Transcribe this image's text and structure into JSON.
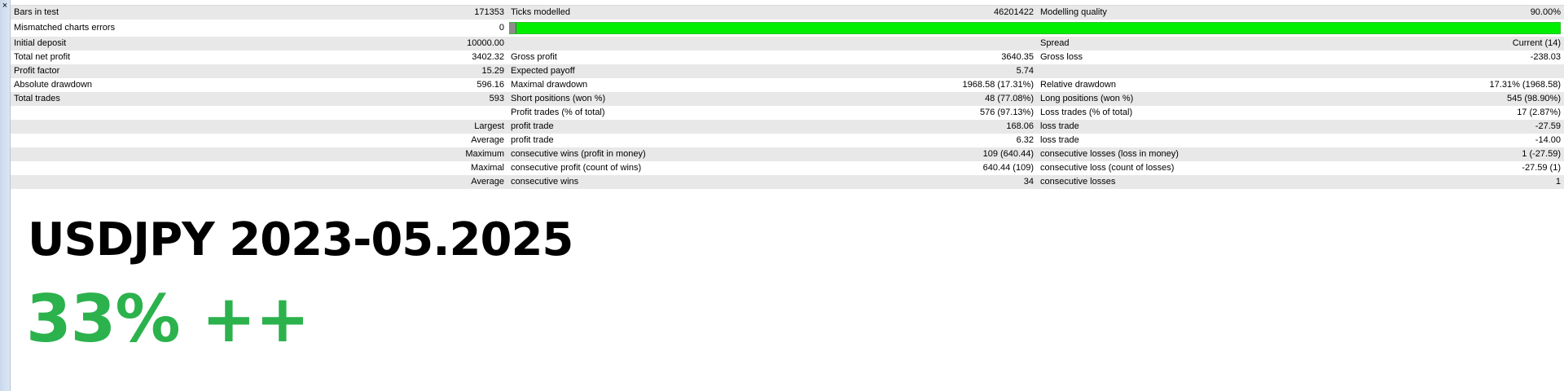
{
  "window": {
    "close_glyph": "×"
  },
  "report": {
    "rows": [
      [
        "Bars in test",
        "171353",
        "Ticks modelled",
        "46201422",
        "Modelling quality",
        "90.00%"
      ],
      [
        "Mismatched charts errors",
        "0",
        "",
        "",
        "",
        ""
      ],
      [
        "Initial deposit",
        "10000.00",
        "",
        "",
        "Spread",
        "Current (14)"
      ],
      [
        "Total net profit",
        "3402.32",
        "Gross profit",
        "3640.35",
        "Gross loss",
        "-238.03"
      ],
      [
        "Profit factor",
        "15.29",
        "Expected payoff",
        "5.74",
        "",
        ""
      ],
      [
        "Absolute drawdown",
        "596.16",
        "Maximal drawdown",
        "1968.58 (17.31%)",
        "Relative drawdown",
        "17.31% (1968.58)"
      ],
      [
        "Total trades",
        "593",
        "Short positions (won %)",
        "48 (77.08%)",
        "Long positions (won %)",
        "545 (98.90%)"
      ],
      [
        "",
        "",
        "Profit trades (% of total)",
        "576 (97.13%)",
        "Loss trades (% of total)",
        "17 (2.87%)"
      ],
      [
        "",
        "Largest",
        "profit trade",
        "168.06",
        "loss trade",
        "-27.59"
      ],
      [
        "",
        "Average",
        "profit trade",
        "6.32",
        "loss trade",
        "-14.00"
      ],
      [
        "",
        "Maximum",
        "consecutive wins (profit in money)",
        "109 (640.44)",
        "consecutive losses (loss in money)",
        "1 (-27.59)"
      ],
      [
        "",
        "Maximal",
        "consecutive profit (count of wins)",
        "640.44 (109)",
        "consecutive loss (count of losses)",
        "-27.59 (1)"
      ],
      [
        "",
        "Average",
        "consecutive wins",
        "34",
        "consecutive losses",
        "1"
      ]
    ],
    "quality_bar": {
      "quality_fraction": 0.9,
      "good_color": "#00ee00",
      "bad_color": "#8c8c8c"
    }
  },
  "overlay": {
    "headline": "USDJPY 2023-05.2025",
    "subline": "33% ++",
    "subline_color": "#2bb24c"
  }
}
